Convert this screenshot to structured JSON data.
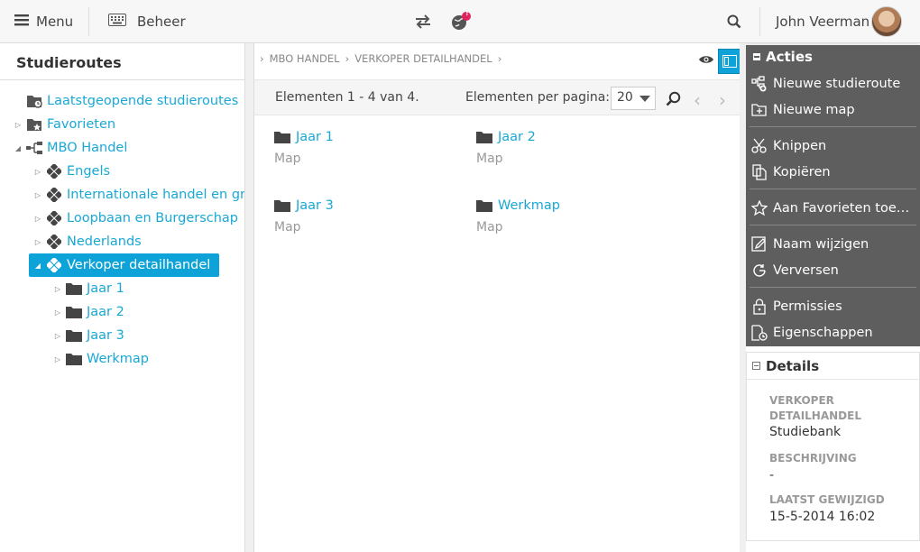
{
  "topbar": {
    "menu_label": "Menu",
    "beheer_label": "Beheer",
    "user_name": "John Veerman",
    "notification_badge": "!"
  },
  "left": {
    "title": "Studieroutes",
    "tree": [
      {
        "label": "Laatstgeopende studieroutes",
        "icon": "recent-folder-icon"
      },
      {
        "label": "Favorieten",
        "icon": "favorite-folder-icon"
      },
      {
        "label": "MBO Handel",
        "icon": "hierarchy-icon"
      },
      {
        "label": "Engels",
        "icon": "module-icon"
      },
      {
        "label": "Internationale handel en groothandel",
        "icon": "module-icon"
      },
      {
        "label": "Loopbaan en Burgerschap",
        "icon": "module-icon"
      },
      {
        "label": "Nederlands",
        "icon": "module-icon"
      },
      {
        "label": "Verkoper detailhandel",
        "icon": "module-icon"
      },
      {
        "label": "Jaar 1",
        "icon": "folder-icon"
      },
      {
        "label": "Jaar 2",
        "icon": "folder-icon"
      },
      {
        "label": "Jaar 3",
        "icon": "folder-icon"
      },
      {
        "label": "Werkmap",
        "icon": "folder-icon"
      }
    ]
  },
  "center": {
    "breadcrumb": [
      "MBO HANDEL",
      "VERKOPER DETAILHANDEL"
    ],
    "pager": {
      "count_text": "Elementen 1 - 4 van 4.",
      "per_page_label": "Elementen per pagina:",
      "per_page_value": "20"
    },
    "tiles": [
      {
        "name": "Jaar 1",
        "type": "Map"
      },
      {
        "name": "Jaar 2",
        "type": "Map"
      },
      {
        "name": "Jaar 3",
        "type": "Map"
      },
      {
        "name": "Werkmap",
        "type": "Map"
      }
    ]
  },
  "actions": {
    "title": "Acties",
    "items": [
      {
        "label": "Nieuwe studieroute",
        "icon": "new-route-icon"
      },
      {
        "label": "Nieuwe map",
        "icon": "new-folder-icon"
      },
      {
        "label": "Knippen",
        "icon": "scissors-icon"
      },
      {
        "label": "Kopiëren",
        "icon": "copy-icon"
      },
      {
        "label": "Aan Favorieten toevoegen",
        "icon": "star-icon"
      },
      {
        "label": "Naam wijzigen",
        "icon": "rename-icon"
      },
      {
        "label": "Verversen",
        "icon": "refresh-icon"
      },
      {
        "label": "Permissies",
        "icon": "lock-icon"
      },
      {
        "label": "Eigenschappen",
        "icon": "properties-icon"
      }
    ]
  },
  "details": {
    "title": "Details",
    "name_label": "VERKOPER DETAILHANDEL",
    "name_value": "Studiebank",
    "desc_label": "BESCHRIJVING",
    "desc_value": "-",
    "modified_label": "LAATST GEWIJZIGD",
    "modified_value": "15-5-2014 16:02"
  },
  "colors": {
    "accent": "#0ea3d8",
    "link": "#19a8d5",
    "actions_bg": "#5e5e5e"
  }
}
